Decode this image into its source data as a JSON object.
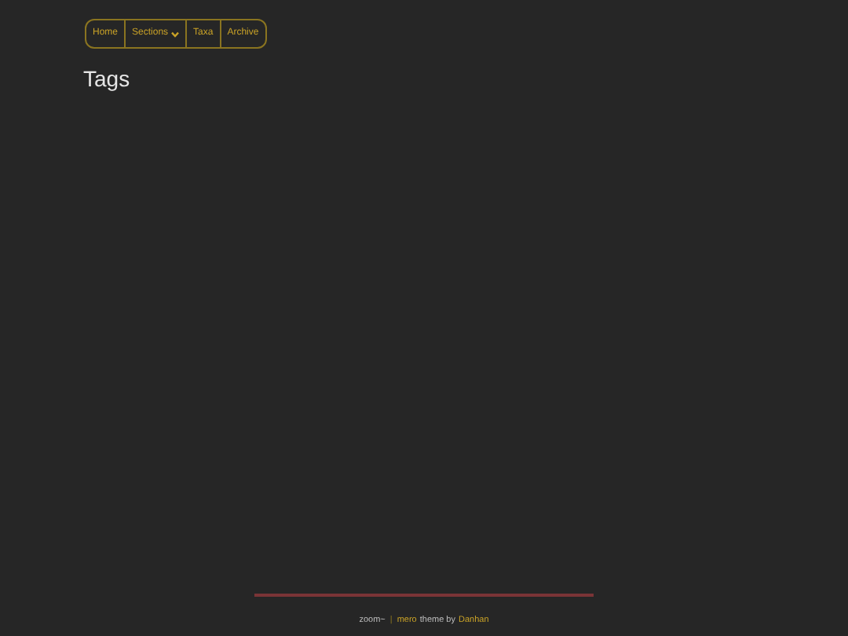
{
  "nav": [
    {
      "label": "Home",
      "kind": "link"
    },
    {
      "label": "Sections",
      "kind": "dropdown"
    },
    {
      "label": "Taxa",
      "kind": "link"
    },
    {
      "label": "Archive",
      "kind": "link"
    }
  ],
  "page_title": "Tags",
  "footer": {
    "site": "zoom~",
    "separator": "|",
    "theme_link": "mero",
    "theme_text": "theme by",
    "author_link": "Danhan"
  }
}
